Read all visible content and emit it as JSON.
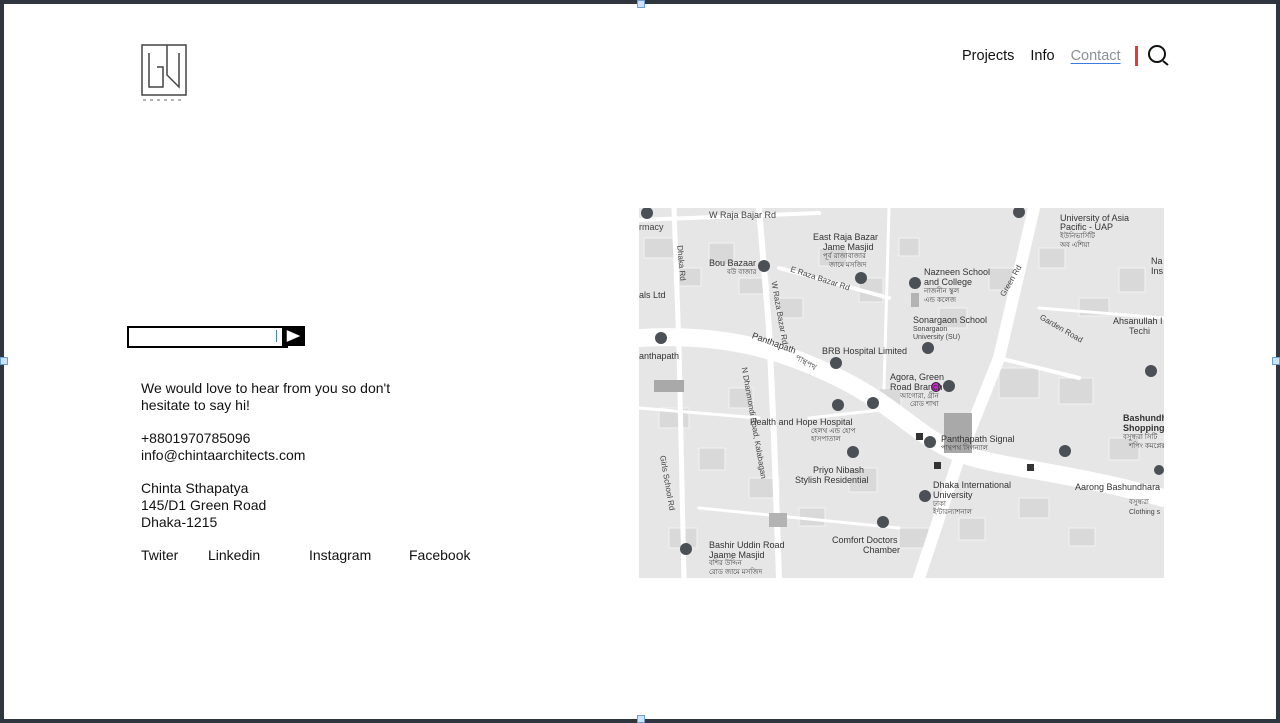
{
  "nav": {
    "items": [
      {
        "label": "Projects"
      },
      {
        "label": "Info"
      },
      {
        "label": "Contact"
      }
    ]
  },
  "intro": {
    "line1": "We would love to hear from you so don't",
    "line2": "hesitate to say hi!"
  },
  "contact": {
    "phone": "+8801970785096",
    "email": "info@chintaarchitects.com"
  },
  "address": {
    "name": "Chinta Sthapatya",
    "street": "145/D1 Green Road",
    "city": "Dhaka-1215"
  },
  "social": [
    "Twiter",
    "Linkedin",
    "Instagram",
    "Facebook"
  ],
  "map": {
    "labels": [
      "W Raja Bajar Rd",
      "rmacy",
      "East Raja Bazar",
      "Jame Masjid",
      "পূর্ব রাজাবাজার",
      "জামে মসজিদ",
      "University of Asia",
      "Pacific - UAP",
      "ইউনিভার্সিটি",
      "অব এশিয়া",
      "Bou Bazaar",
      "বউ বাজার",
      "E Raza Bazar Rd",
      "Nazneen School",
      "and College",
      "নাজনীন স্কুল",
      "এন্ড কলেজ",
      "Green Rd",
      "als Ltd",
      "Sonargaon School",
      "Sonargaon",
      "University (SU)",
      "Garden Road",
      "Ahsanullah I",
      "Techi",
      "Panthapath",
      "BRB Hospital Limited",
      "anthapath",
      "পান্থপথ",
      "Agora, Green",
      "Road Branch",
      "আগোরা, গ্রীন",
      "রোড শাখা",
      "Bashundh",
      "Shopping",
      "বসুন্ধরা সিটি",
      "শপিং কমপ্লেক্স",
      "Health and Hope Hospital",
      "হেলথ এন্ড হোপ",
      "হাসপাতাল",
      "Panthapath Signal",
      "পান্থপথ সিগন্যাল",
      "Priyo Nibash",
      "Stylish Residential",
      "Dhaka International",
      "University",
      "ঢাকা",
      "ইন্টারন্যাশনাল",
      "Aarong Bashundhara",
      "বসুন্ধরা",
      "Clothing s",
      "Comfort Doctors",
      "Chamber",
      "Bashir Uddin Road",
      "Jaame Masjid",
      "বশির উদ্দিন",
      "রোড জামে মসজিদ",
      "Girls School Rd",
      "N Dhanmondi Road, Kalabagan",
      "W Raza Bazar Rd",
      "Dhaka Rd",
      "Na",
      "Ins"
    ]
  },
  "colors": {
    "accent_red": "#e53935",
    "link_underline": "#3b7be0",
    "map_bg": "#e9e9e9",
    "road": "#ffffff",
    "marker": "#4b4f56",
    "pin": "#d61fd6"
  },
  "icons": {
    "logo": "chinta-logo",
    "search": "search-icon",
    "send": "play-arrow-icon"
  }
}
